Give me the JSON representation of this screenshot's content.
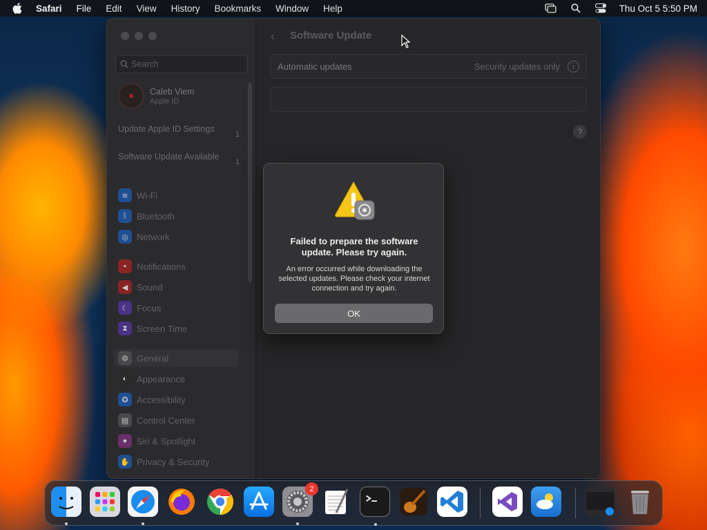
{
  "menubar": {
    "app_name": "Safari",
    "items": [
      "File",
      "Edit",
      "View",
      "History",
      "Bookmarks",
      "Window",
      "Help"
    ],
    "clock": "Thu Oct 5  5:50 PM"
  },
  "sidebar": {
    "search_placeholder": "Search",
    "account_name": "Caleb Viem",
    "account_sub": "Apple ID",
    "notices": [
      {
        "label": "Update Apple ID Settings",
        "count": "1"
      },
      {
        "label": "Software Update Available",
        "count": "1"
      }
    ],
    "items": [
      {
        "label": "Wi-Fi",
        "icon": "wifi-icon",
        "color": "#1f5fb3"
      },
      {
        "label": "Bluetooth",
        "icon": "bluetooth-icon",
        "color": "#1f5fb3"
      },
      {
        "label": "Network",
        "icon": "globe-icon",
        "color": "#1f5fb3"
      },
      {
        "label": "Notifications",
        "icon": "bell-icon",
        "color": "#b02b2b"
      },
      {
        "label": "Sound",
        "icon": "speaker-icon",
        "color": "#b02b2b"
      },
      {
        "label": "Focus",
        "icon": "moon-icon",
        "color": "#5a3aa6"
      },
      {
        "label": "Screen Time",
        "icon": "hourglass-icon",
        "color": "#5a3aa6"
      },
      {
        "label": "General",
        "icon": "gear-icon",
        "color": "#555557"
      },
      {
        "label": "Appearance",
        "icon": "circle-half-icon",
        "color": "#2a2a2a"
      },
      {
        "label": "Accessibility",
        "icon": "accessibility-icon",
        "color": "#1f5fb3"
      },
      {
        "label": "Control Center",
        "icon": "switches-icon",
        "color": "#555557"
      },
      {
        "label": "Siri & Spotlight",
        "icon": "siri-icon",
        "color": "#8a3a8a"
      },
      {
        "label": "Privacy & Security",
        "icon": "hand-icon",
        "color": "#1f5fb3"
      }
    ]
  },
  "content": {
    "title": "Software Update",
    "auto_updates_label": "Automatic updates",
    "auto_updates_value": "Security updates only",
    "help_label": "?"
  },
  "alert": {
    "heading": "Failed to prepare the software update. Please try again.",
    "body": "An error occurred while downloading the selected updates. Please check your internet connection and try again.",
    "ok_label": "OK"
  },
  "dock": {
    "settings_badge": "2"
  }
}
